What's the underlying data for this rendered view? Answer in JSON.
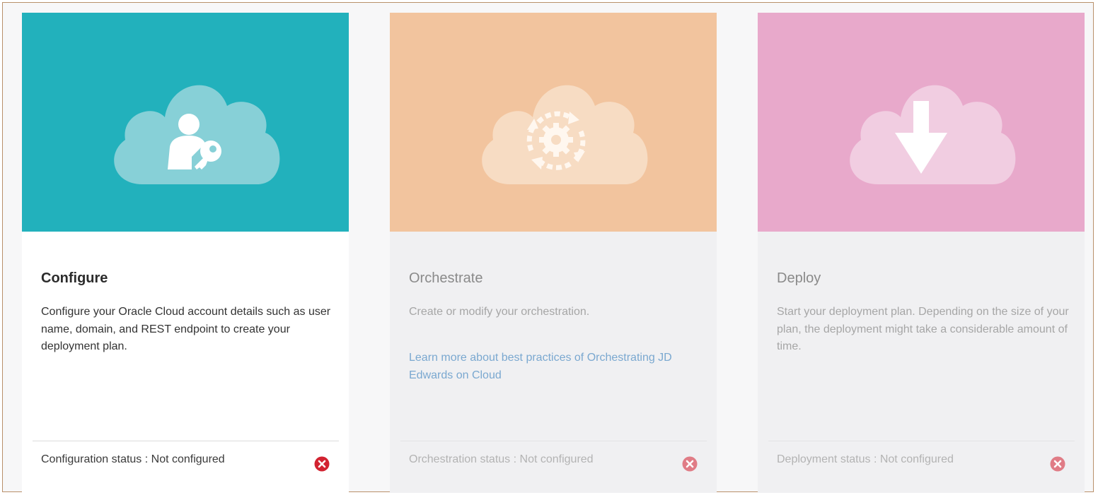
{
  "colors": {
    "configure_hero": "#22b1bc",
    "orchestrate_hero": "#f2c49e",
    "deploy_hero": "#e8a9cb",
    "link": "#7aa8d0",
    "error_active": "#d22230",
    "error_inactive": "#e07c86"
  },
  "cards": [
    {
      "title": "Configure",
      "description": "Configure your Oracle Cloud account details such as user name, domain, and REST endpoint to create your deployment plan.",
      "status": "Configuration status : Not configured",
      "icon": "user-key-icon",
      "status_icon": "error-x-icon"
    },
    {
      "title": "Orchestrate",
      "description": "Create or modify your orchestration.",
      "link": "Learn more about best practices of Orchestrating JD Edwards on Cloud",
      "status": "Orchestration status : Not configured",
      "icon": "gear-cycle-icon",
      "status_icon": "error-x-icon"
    },
    {
      "title": "Deploy",
      "description": "Start your deployment plan. Depending on the size of your plan, the deployment might take a considerable amount of time.",
      "status": "Deployment status : Not configured",
      "icon": "download-arrow-icon",
      "status_icon": "error-x-icon"
    }
  ]
}
